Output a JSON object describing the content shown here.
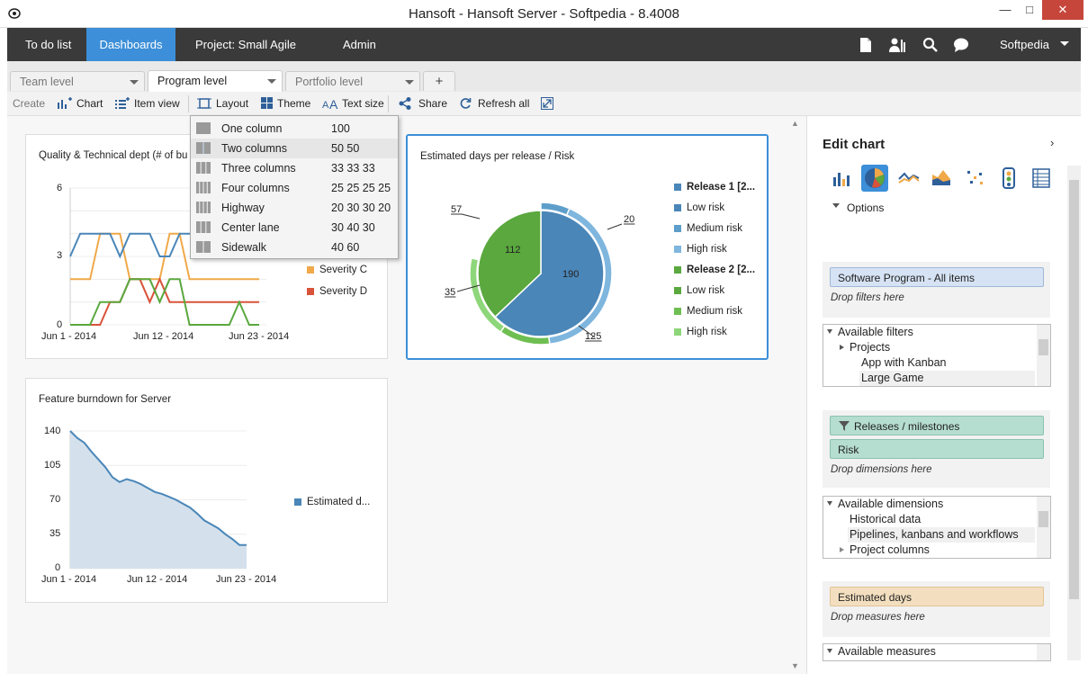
{
  "window": {
    "title": "Hansoft - Hansoft Server - Softpedia - 8.4008"
  },
  "nav": {
    "items": [
      "To do list",
      "Dashboards",
      "Project: Small Agile",
      "Admin"
    ],
    "user": "Softpedia"
  },
  "tabs": [
    {
      "label": "Team level"
    },
    {
      "label": "Program level"
    },
    {
      "label": "Portfolio level"
    }
  ],
  "toolbar": {
    "create": "Create",
    "chart": "Chart",
    "item_view": "Item view",
    "layout": "Layout",
    "theme": "Theme",
    "text_size": "Text size",
    "share": "Share",
    "refresh_all": "Refresh all"
  },
  "layout_menu": [
    {
      "label": "One column",
      "value": "100"
    },
    {
      "label": "Two columns",
      "value": "50 50"
    },
    {
      "label": "Three columns",
      "value": "33 33 33"
    },
    {
      "label": "Four columns",
      "value": "25 25 25 25"
    },
    {
      "label": "Highway",
      "value": "20 30 30 20"
    },
    {
      "label": "Center lane",
      "value": "30 40 30"
    },
    {
      "label": "Sidewalk",
      "value": "40 60"
    }
  ],
  "charts": {
    "quality": {
      "title": "Quality & Technical dept (# of bu",
      "y_ticks": [
        "6",
        "3",
        "0"
      ],
      "x_ticks": [
        "Jun 1 - 2014",
        "Jun 12 - 2014",
        "Jun 23 - 2014"
      ],
      "legend": [
        {
          "name": "Severity C",
          "color": "#f0a848"
        },
        {
          "name": "Severity D",
          "color": "#d9533a"
        }
      ]
    },
    "pie": {
      "title": "Estimated days per release / Risk",
      "callouts": [
        "57",
        "20",
        "112",
        "190",
        "35",
        "125"
      ],
      "legend": [
        {
          "name": "Release 1 [2...",
          "color": "#4a86b8",
          "bold": true
        },
        {
          "name": "Low risk",
          "color": "#4a86b8",
          "bold": false
        },
        {
          "name": "Medium risk",
          "color": "#5d9ecb",
          "bold": false
        },
        {
          "name": "High risk",
          "color": "#7fb6de",
          "bold": false
        },
        {
          "name": "Release 2 [2...",
          "color": "#5aa83e",
          "bold": true
        },
        {
          "name": "Low risk",
          "color": "#5aa83e",
          "bold": false
        },
        {
          "name": "Medium risk",
          "color": "#6fbe52",
          "bold": false
        },
        {
          "name": "High risk",
          "color": "#8ed67a",
          "bold": false
        }
      ]
    },
    "burndown": {
      "title": "Feature burndown for Server",
      "y_ticks": [
        "140",
        "105",
        "70",
        "35",
        "0"
      ],
      "x_ticks": [
        "Jun 1 - 2014",
        "Jun 12 - 2014",
        "Jun 23 - 2014"
      ],
      "legend": [
        {
          "name": "Estimated d...",
          "color": "#4a86b8"
        }
      ]
    }
  },
  "chart_data": [
    {
      "type": "line",
      "title": "Quality & Technical dept (# of bu",
      "ylim": [
        0,
        6
      ],
      "series": [
        {
          "name": "Severity C",
          "values": [
            2,
            2,
            2,
            4,
            4,
            4,
            2,
            2,
            2,
            2,
            4,
            4,
            2,
            2,
            2,
            2,
            2,
            2,
            2,
            2
          ]
        },
        {
          "name": "Severity D",
          "values": [
            0,
            0,
            0,
            0,
            1,
            1,
            2,
            2,
            1,
            2,
            1,
            1,
            1,
            1,
            1,
            1,
            1,
            1,
            1,
            1
          ]
        },
        {
          "values": [
            3,
            4,
            4,
            4,
            4,
            3,
            4,
            4,
            4,
            3,
            3,
            4,
            4,
            4,
            4,
            4,
            4,
            4,
            3,
            3
          ]
        },
        {
          "values": [
            0,
            0,
            0,
            1,
            1,
            1,
            2,
            2,
            2,
            1,
            2,
            2,
            0,
            0,
            0,
            0,
            0,
            1,
            0,
            0
          ]
        }
      ]
    },
    {
      "type": "pie",
      "title": "Estimated days per release / Risk",
      "inner": [
        {
          "label": "Release 1",
          "value": 190
        },
        {
          "label": "Release 2",
          "value": 112
        }
      ],
      "outer": [
        {
          "value": 20
        },
        {
          "value": 125
        },
        {
          "value": 35
        },
        {
          "value": 57
        }
      ]
    },
    {
      "type": "area",
      "title": "Feature burndown for Server",
      "ylim": [
        0,
        140
      ],
      "series": [
        {
          "name": "Estimated d...",
          "values": [
            140,
            133,
            128,
            119,
            111,
            103,
            93,
            88,
            91,
            89,
            86,
            82,
            78,
            76,
            73,
            70,
            66,
            62,
            56,
            49,
            45,
            41,
            35,
            30,
            24,
            24
          ]
        }
      ]
    }
  ],
  "edit_chart": {
    "title": "Edit chart",
    "options": "Options",
    "filter_pill": "Software Program - All items",
    "drop_filters": "Drop filters here",
    "filters_tree": [
      "Available filters",
      "Projects",
      "App with Kanban",
      "Large Game"
    ],
    "dim_pills": [
      "Releases / milestones",
      "Risk"
    ],
    "drop_dimensions": "Drop dimensions here",
    "dims_tree": [
      "Available dimensions",
      "Historical data",
      "Pipelines, kanbans and workflows",
      "Project columns"
    ],
    "measure_pill": "Estimated days",
    "drop_measures": "Drop measures here",
    "measures_tree": [
      "Available measures"
    ]
  }
}
